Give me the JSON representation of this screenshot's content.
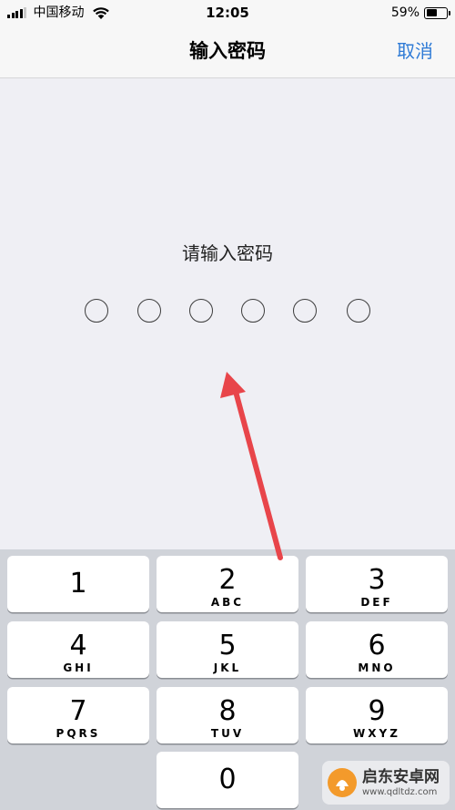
{
  "status_bar": {
    "carrier": "中国移动",
    "time": "12:05",
    "battery_percent": "59%",
    "battery_level": 0.59,
    "signal_bars": 4
  },
  "nav": {
    "title": "输入密码",
    "cancel": "取消"
  },
  "prompt": "请输入密码",
  "passcode_length": 6,
  "keypad": {
    "keys": [
      {
        "num": "1",
        "letters": ""
      },
      {
        "num": "2",
        "letters": "ABC"
      },
      {
        "num": "3",
        "letters": "DEF"
      },
      {
        "num": "4",
        "letters": "GHI"
      },
      {
        "num": "5",
        "letters": "JKL"
      },
      {
        "num": "6",
        "letters": "MNO"
      },
      {
        "num": "7",
        "letters": "PQRS"
      },
      {
        "num": "8",
        "letters": "TUV"
      },
      {
        "num": "9",
        "letters": "WXYZ"
      },
      {
        "num": "0",
        "letters": ""
      }
    ]
  },
  "watermark": {
    "title": "启东安卓网",
    "url": "www.qdltdz.com"
  },
  "colors": {
    "accent": "#2f7bd6",
    "arrow": "#e8454a",
    "background": "#efeff4",
    "keypad_bg": "#d0d3d9"
  }
}
